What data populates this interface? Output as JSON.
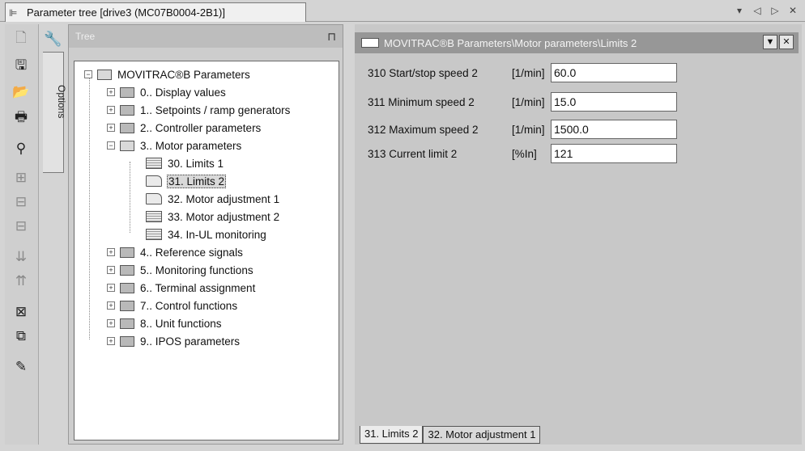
{
  "window": {
    "title": "Parameter tree [drive3 (MC07B0004-2B1)]",
    "controls": [
      "▾",
      "◁",
      "▷",
      "✕"
    ]
  },
  "options": {
    "label": "Options"
  },
  "tree": {
    "header": "Tree",
    "root": "MOVITRAC®B Parameters",
    "groups": [
      "0.. Display values",
      "1.. Setpoints / ramp generators",
      "2.. Controller parameters",
      "3.. Motor parameters",
      "4.. Reference signals",
      "5.. Monitoring functions",
      "6.. Terminal assignment",
      "7.. Control functions",
      "8.. Unit functions",
      "9.. IPOS parameters"
    ],
    "motor_children": [
      "30. Limits 1",
      "31. Limits 2",
      "32. Motor adjustment 1",
      "33. Motor adjustment 2",
      "34. In-UL monitoring"
    ],
    "selected": "31. Limits 2"
  },
  "detail": {
    "title": "MOVITRAC®B Parameters\\Motor parameters\\Limits 2",
    "params": [
      {
        "name": "310 Start/stop speed 2",
        "unit": "[1/min]",
        "value": "60.0"
      },
      {
        "name": "311 Minimum speed 2",
        "unit": "[1/min]",
        "value": "15.0"
      },
      {
        "name": "312 Maximum speed 2",
        "unit": "[1/min]",
        "value": "1500.0"
      },
      {
        "name": "313 Current limit 2",
        "unit": "[%In]",
        "value": "121"
      }
    ],
    "tabs": [
      "31. Limits 2",
      "32. Motor adjustment 1"
    ]
  }
}
